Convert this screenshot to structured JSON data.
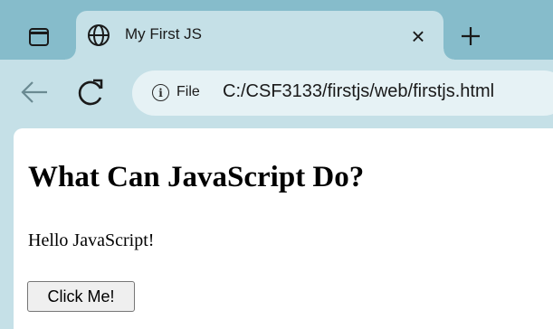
{
  "browser": {
    "tab": {
      "title": "My First JS",
      "close_glyph": "×",
      "favicon": "globe-icon"
    },
    "tab_actions_icon": "tab-actions-icon",
    "new_tab_icon": "plus-icon",
    "toolbar": {
      "back_icon": "back-arrow-icon",
      "reload_icon": "reload-icon"
    },
    "address_bar": {
      "security_icon": "info-icon",
      "info_glyph": "i",
      "chip_label": "File",
      "url": "C:/CSF3133/firstjs/web/firstjs.html"
    }
  },
  "page": {
    "heading": "What Can JavaScript Do?",
    "demo_text": "Hello JavaScript!",
    "button_label": "Click Me!"
  },
  "colors": {
    "tabstrip": "#86bccb",
    "toolbar": "#c5e0e7",
    "omnibox": "#e6f2f5",
    "page_background": "#ffffff"
  }
}
